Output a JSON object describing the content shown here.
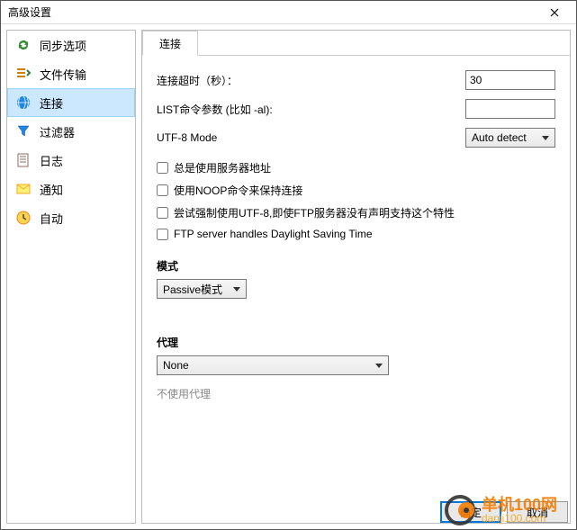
{
  "window": {
    "title": "高级设置"
  },
  "sidebar": {
    "items": [
      {
        "label": "同步选项"
      },
      {
        "label": "文件传输"
      },
      {
        "label": "连接",
        "selected": true
      },
      {
        "label": "过滤器"
      },
      {
        "label": "日志"
      },
      {
        "label": "通知"
      },
      {
        "label": "自动"
      }
    ]
  },
  "tabs": {
    "active": "连接"
  },
  "form": {
    "timeout_label": "连接超时（秒）：",
    "timeout_value": "30",
    "list_args_label": "LIST命令参数 (比如 -al):",
    "list_args_value": "",
    "utf8_label": "UTF-8 Mode",
    "utf8_value": "Auto detect",
    "chk_server_addr": "总是使用服务器地址",
    "chk_noop": "使用NOOP命令来保持连接",
    "chk_force_utf8": "尝试强制使用UTF-8,即使FTP服务器没有声明支持这个特性",
    "chk_dst": "FTP server handles Daylight Saving Time",
    "mode_section": "模式",
    "mode_value": "Passive模式",
    "proxy_section": "代理",
    "proxy_value": "None",
    "proxy_hint": "不使用代理"
  },
  "footer": {
    "ok": "确定",
    "cancel": "取消"
  },
  "watermark": {
    "line1": "单机100网",
    "line2": "danji100.com"
  }
}
